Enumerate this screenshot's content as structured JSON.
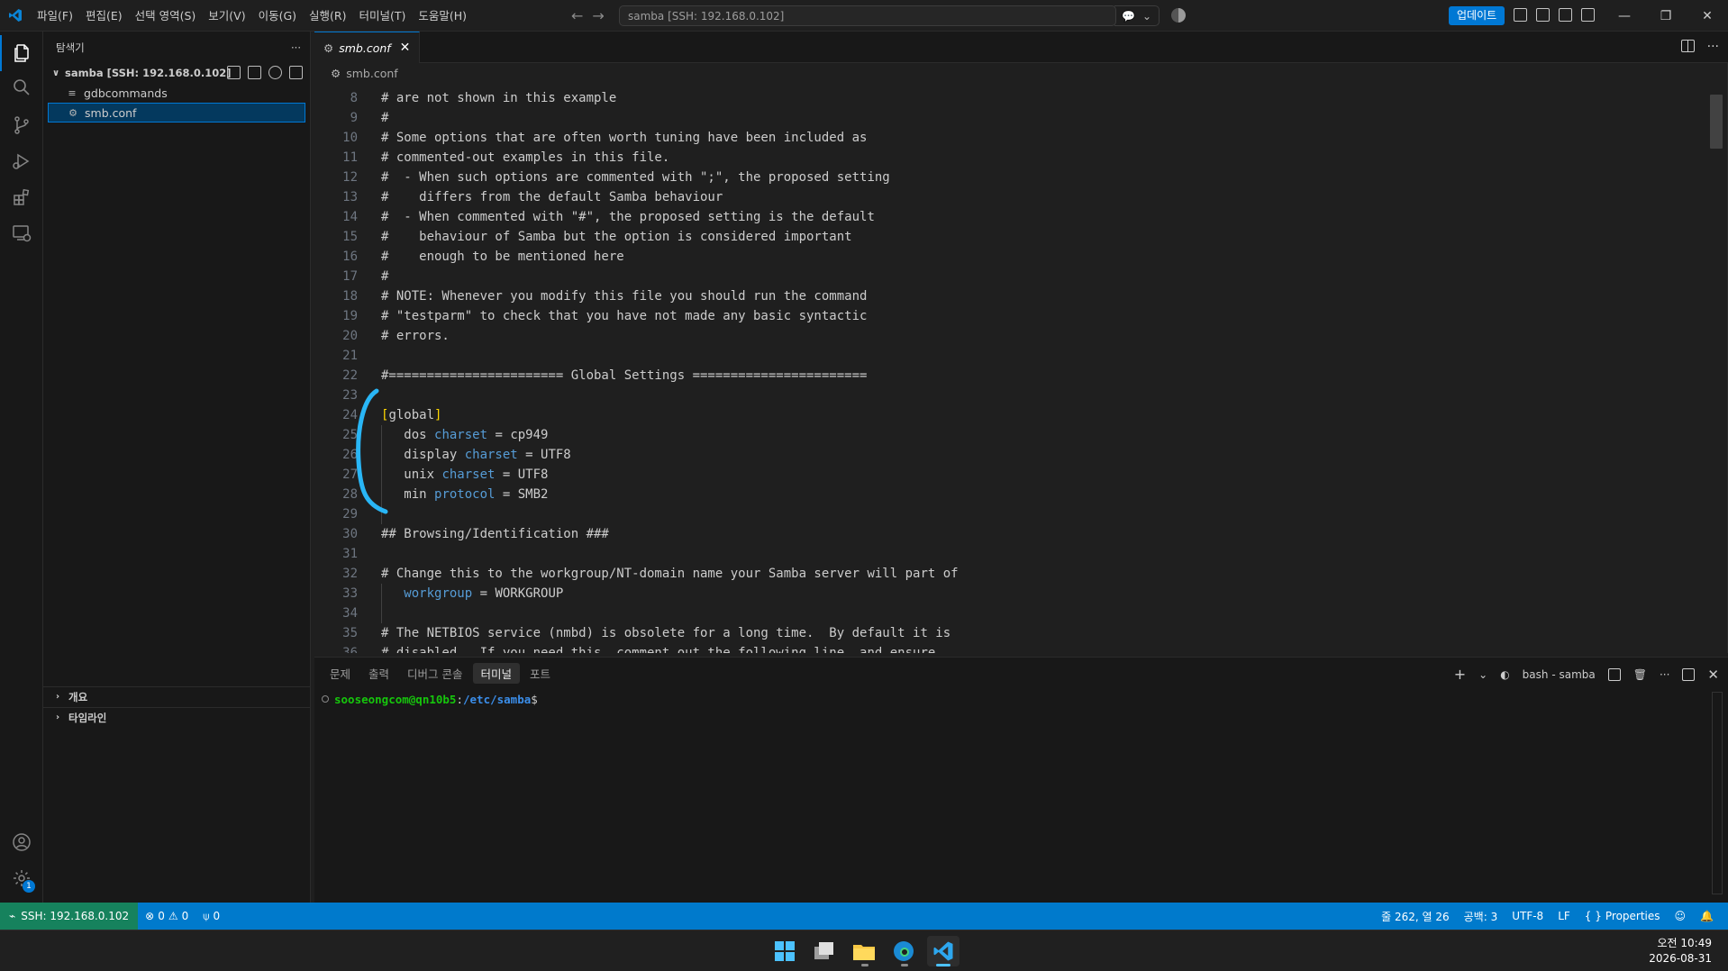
{
  "titlebar": {
    "menus": [
      "파일(F)",
      "편집(E)",
      "선택 영역(S)",
      "보기(V)",
      "이동(G)",
      "실행(R)",
      "터미널(T)",
      "도움말(H)"
    ],
    "search_text": "samba [SSH: 192.168.0.102]",
    "update_label": "업데이트",
    "accent": "#0078d4"
  },
  "activitybar": {
    "icons": [
      "explorer-icon",
      "search-icon",
      "source-control-icon",
      "run-debug-icon",
      "extensions-icon",
      "remote-explorer-icon",
      "account-icon",
      "settings-gear-icon"
    ],
    "settings_badge": "1"
  },
  "sidebar": {
    "title": "탐색기",
    "more": "···",
    "folder": "samba [SSH: 192.168.0.102]",
    "files": [
      {
        "name": "gdbcommands",
        "icon": "≡",
        "selected": false
      },
      {
        "name": "smb.conf",
        "icon": "⚙",
        "selected": true
      }
    ],
    "sections": [
      "개요",
      "타임라인"
    ]
  },
  "editor": {
    "tab_label": "smb.conf",
    "breadcrumb": "smb.conf",
    "lines": [
      {
        "n": "8",
        "t": "# are not shown in this example"
      },
      {
        "n": "9",
        "t": "#"
      },
      {
        "n": "10",
        "t": "# Some options that are often worth tuning have been included as"
      },
      {
        "n": "11",
        "t": "# commented-out examples in this file."
      },
      {
        "n": "12",
        "t": "#  - When such options are commented with \";\", the proposed setting"
      },
      {
        "n": "13",
        "t": "#    differs from the default Samba behaviour"
      },
      {
        "n": "14",
        "t": "#  - When commented with \"#\", the proposed setting is the default"
      },
      {
        "n": "15",
        "t": "#    behaviour of Samba but the option is considered important"
      },
      {
        "n": "16",
        "t": "#    enough to be mentioned here"
      },
      {
        "n": "17",
        "t": "#"
      },
      {
        "n": "18",
        "t": "# NOTE: Whenever you modify this file you should run the command"
      },
      {
        "n": "19",
        "t": "# \"testparm\" to check that you have not made any basic syntactic"
      },
      {
        "n": "20",
        "t": "# errors."
      },
      {
        "n": "21",
        "t": ""
      },
      {
        "n": "22",
        "t": "#======================= Global Settings ======================="
      },
      {
        "n": "23",
        "t": ""
      },
      {
        "n": "24",
        "t": "[global]"
      },
      {
        "n": "25",
        "t": "   dos charset = cp949"
      },
      {
        "n": "26",
        "t": "   display charset = UTF8"
      },
      {
        "n": "27",
        "t": "   unix charset = UTF8"
      },
      {
        "n": "28",
        "t": "   min protocol = SMB2"
      },
      {
        "n": "29",
        "t": ""
      },
      {
        "n": "30",
        "t": "## Browsing/Identification ###"
      },
      {
        "n": "31",
        "t": ""
      },
      {
        "n": "32",
        "t": "# Change this to the workgroup/NT-domain name your Samba server will part of"
      },
      {
        "n": "33",
        "t": "   workgroup = WORKGROUP"
      },
      {
        "n": "34",
        "t": ""
      },
      {
        "n": "35",
        "t": "# The NETBIOS service (nmbd) is obsolete for a long time.  By default it is"
      },
      {
        "n": "36",
        "t": "# disabled.  If you need this, comment out the following line, and ensure"
      }
    ]
  },
  "panel": {
    "tabs": [
      "문제",
      "출력",
      "디버그 콘솔",
      "터미널",
      "포트"
    ],
    "active_tab": "터미널",
    "terminal_name": "bash - samba",
    "prompt_user": "sooseongcom@qn10b5",
    "prompt_sep": ":",
    "prompt_path": "/etc/samba",
    "prompt_end": "$"
  },
  "statusbar": {
    "remote": "SSH: 192.168.0.102",
    "errors": "0",
    "warnings": "0",
    "ports": "0",
    "position": "줄 262, 열 26",
    "spaces": "공백: 3",
    "encoding": "UTF-8",
    "eol": "LF",
    "language": "Properties"
  },
  "taskbar": {
    "time": "오전 10:49",
    "date": "2026-08-31"
  }
}
